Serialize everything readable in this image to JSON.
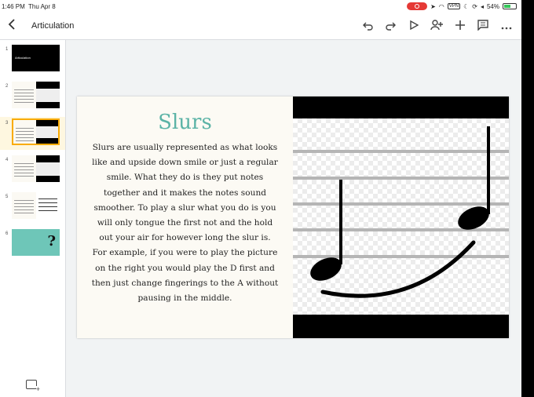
{
  "status_bar": {
    "time": "1:46 PM",
    "date": "Thu Apr 8",
    "vpn": "VPN",
    "battery": "54%",
    "battery_fraction": 0.54
  },
  "toolbar": {
    "title": "Articulation",
    "back_icon": "chevron-left-icon",
    "icons": [
      "undo-icon",
      "redo-icon",
      "play-icon",
      "add-person-icon",
      "plus-icon",
      "comment-icon",
      "more-icon"
    ]
  },
  "sidebar": {
    "slides": [
      {
        "number": "1",
        "label": "Articulation"
      },
      {
        "number": "2"
      },
      {
        "number": "3"
      },
      {
        "number": "4"
      },
      {
        "number": "5"
      },
      {
        "number": "6"
      }
    ],
    "selected_index": 2
  },
  "slide": {
    "title": "Slurs",
    "body": "Slurs are usually represented as what looks like and upside down smile or just a regular smile. What they do is they put notes together and it makes the notes sound smoother. To  play a slur what you do is you will only tongue the first not and the hold out your air for however long the slur is. For example, if you were to play the picture on the right you would play the D first and then just change fingerings to the A without pausing in the middle.",
    "image_icon": "music-slur-image"
  },
  "colors": {
    "title_teal": "#5bb3a6",
    "selected_thumb": "#f9ab00",
    "record_red": "#e53935",
    "battery_green": "#34c759"
  }
}
